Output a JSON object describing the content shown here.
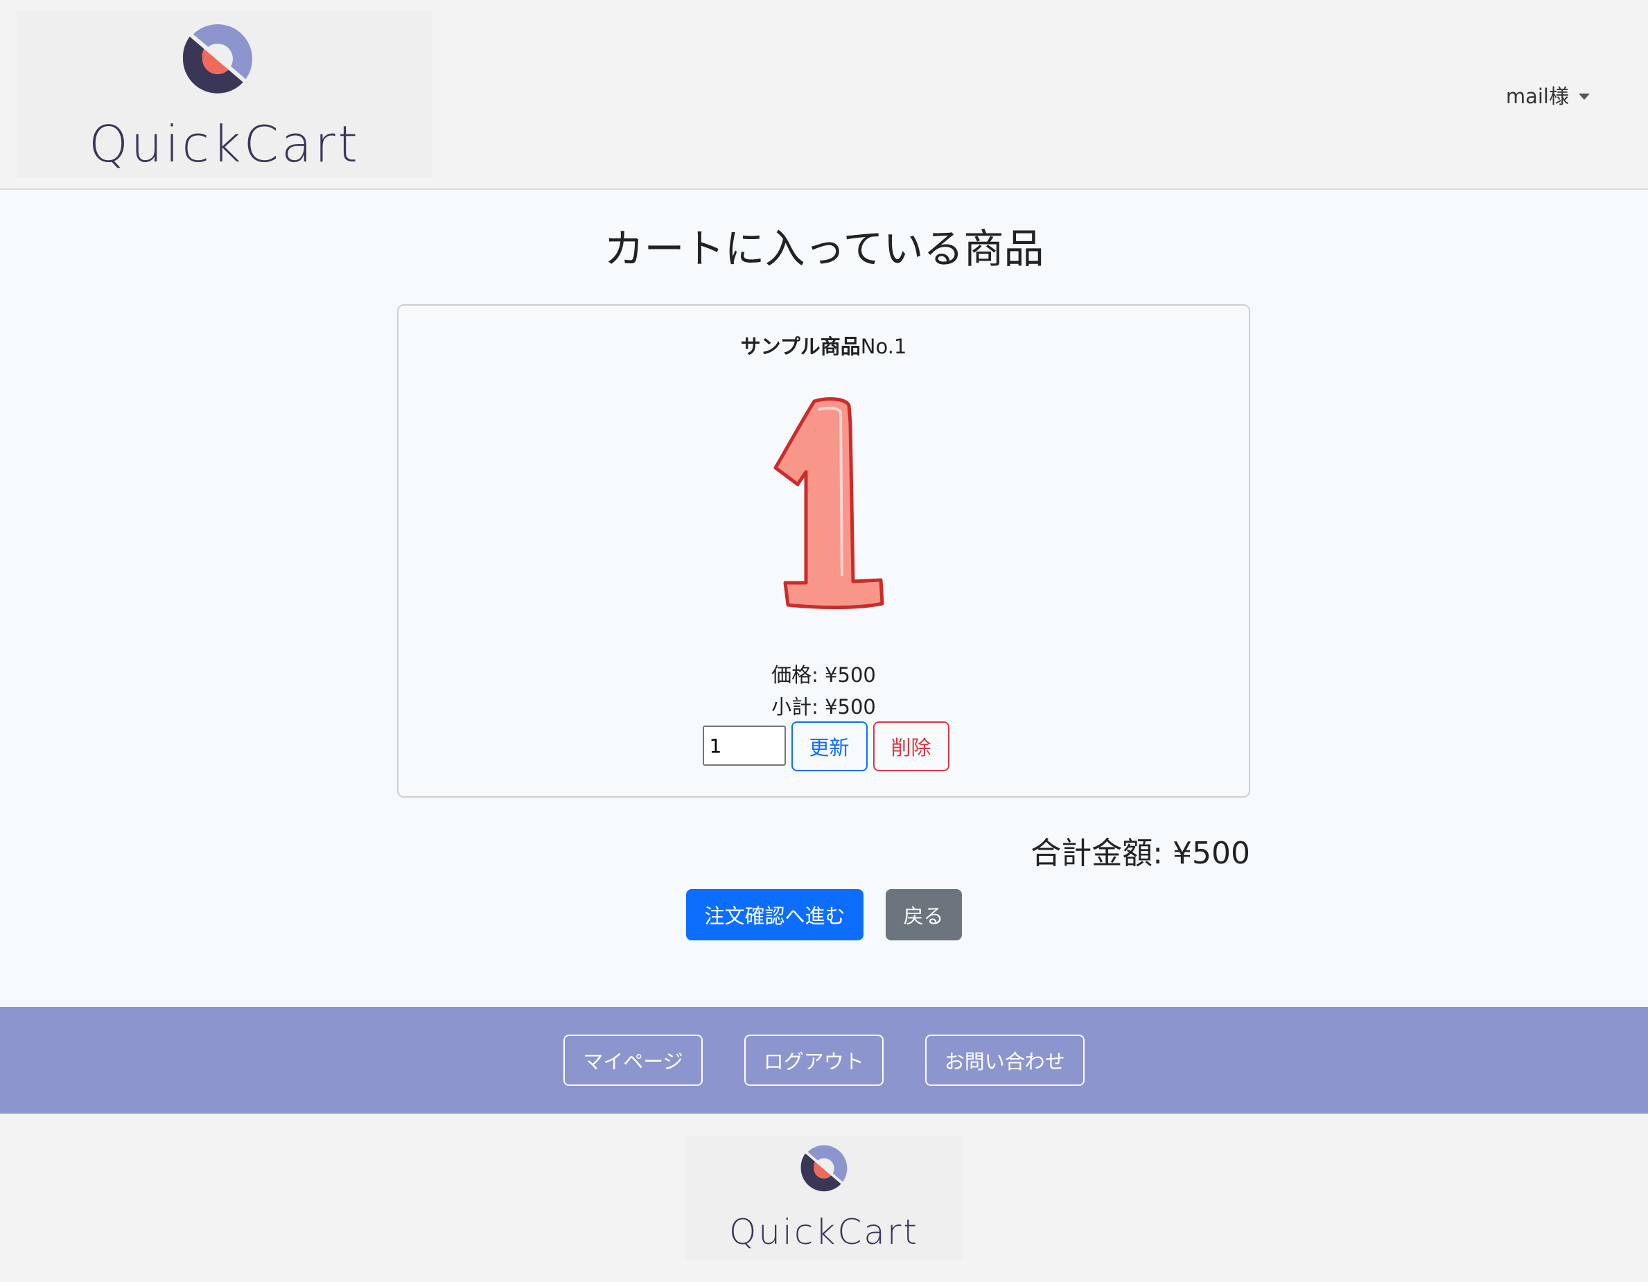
{
  "header": {
    "logo_text": "QuickCart",
    "user_menu_label": "mail様"
  },
  "main": {
    "title": "カートに入っている商品",
    "item": {
      "name_bold": "サンプル商品",
      "name_suffix": "No.1",
      "image_numeral": "1",
      "price_line": "価格: ¥500",
      "subtotal_line": "小計: ¥500",
      "quantity_value": "1",
      "update_label": "更新",
      "delete_label": "削除"
    },
    "total_line": "合計金額: ¥500",
    "checkout_label": "注文確認へ進む",
    "back_label": "戻る"
  },
  "footer": {
    "nav": [
      {
        "label": "マイページ"
      },
      {
        "label": "ログアウト"
      },
      {
        "label": "お問い合わせ"
      }
    ],
    "logo_text": "QuickCart"
  },
  "colors": {
    "primary": "#0d6efd",
    "danger": "#dc3545",
    "secondary": "#6c757d",
    "footer_nav_bg": "#8c95ce",
    "logo_dark": "#3a3656",
    "logo_light": "#8c95ce",
    "logo_accent": "#ef6a5a"
  }
}
